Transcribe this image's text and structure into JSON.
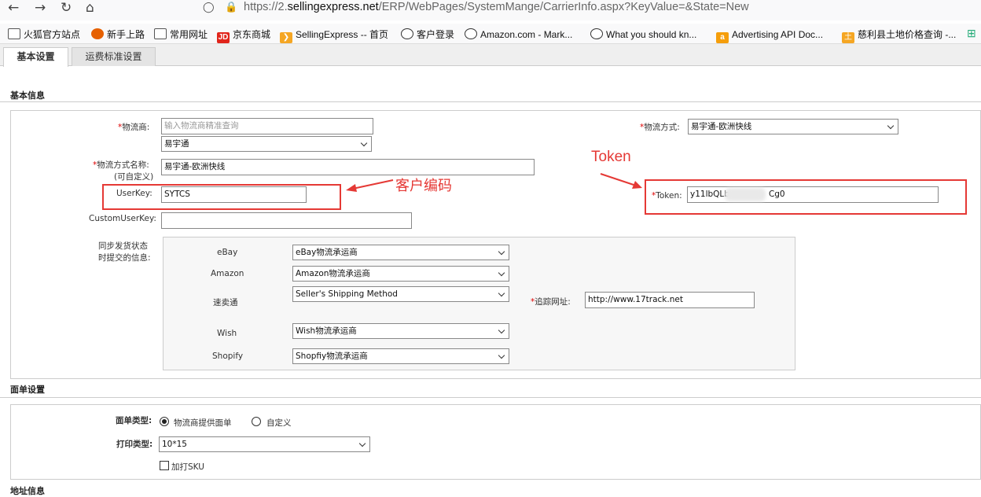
{
  "browser": {
    "url_prefix": "https://2.",
    "url_domain": "sellingexpress.net",
    "url_path": "/ERP/WebPages/SystemMange/CarrierInfo.aspx?KeyValue=&State=New",
    "bookmarks": [
      {
        "label": "火狐官方站点",
        "icon": "folder-icon"
      },
      {
        "label": "新手上路",
        "icon": "firefox-icon"
      },
      {
        "label": "常用网址",
        "icon": "folder-icon"
      },
      {
        "label": "京东商城",
        "icon": "jd-icon"
      },
      {
        "label": "SellingExpress -- 首页",
        "icon": "sellingexpress-icon"
      },
      {
        "label": "客户登录",
        "icon": "globe-icon"
      },
      {
        "label": "Amazon.com - Mark...",
        "icon": "globe-icon"
      },
      {
        "label": "What you should kn...",
        "icon": "globe-icon"
      },
      {
        "label": "Advertising API Doc...",
        "icon": "amazon-icon"
      },
      {
        "label": "慈利县土地价格查询 -...",
        "icon": "land-icon"
      }
    ]
  },
  "tabs": [
    {
      "label": "基本设置",
      "active": true
    },
    {
      "label": "运费标准设置",
      "active": false
    }
  ],
  "basic": {
    "title": "基本信息",
    "carrier_label": "物流商:",
    "carrier_placeholder": "输入物流商精准查询",
    "carrier_select": "易宇通",
    "method_label": "物流方式:",
    "method_select": "易宇通-欧洲快线",
    "method_name_label": "物流方式名称:",
    "method_name_sub": "(可自定义)",
    "method_name_value": "易宇通-欧洲快线",
    "userkey_label": "UserKey:",
    "userkey_value": "SYTCS",
    "token_label": "Token:",
    "token_value_start": "y11lbQLb",
    "token_value_end": "Cg0",
    "custom_userkey_label": "CustomUserKey:",
    "custom_userkey_value": "",
    "sync_label_1": "同步发货状态",
    "sync_label_2": "时提交的信息:",
    "platforms": [
      {
        "name": "eBay",
        "value": "eBay物流承运商"
      },
      {
        "name": "Amazon",
        "value": "Amazon物流承运商"
      },
      {
        "name": "速卖通",
        "value": "Seller's Shipping Method"
      },
      {
        "name": "Wish",
        "value": "Wish物流承运商"
      },
      {
        "name": "Shopify",
        "value": "Shopfiy物流承运商"
      }
    ],
    "tracking_label": "追踪网址:",
    "tracking_value": "http://www.17track.net"
  },
  "annotations": {
    "customer_code": "客户编码",
    "token": "Token",
    "color": "#e53935"
  },
  "waybill": {
    "title": "面单设置",
    "type_label": "面单类型:",
    "type_option_1": "物流商提供面单",
    "type_option_2": "自定义",
    "print_label": "打印类型:",
    "print_value": "10*15",
    "sku_label": "加打SKU"
  },
  "address": {
    "title": "地址信息"
  }
}
